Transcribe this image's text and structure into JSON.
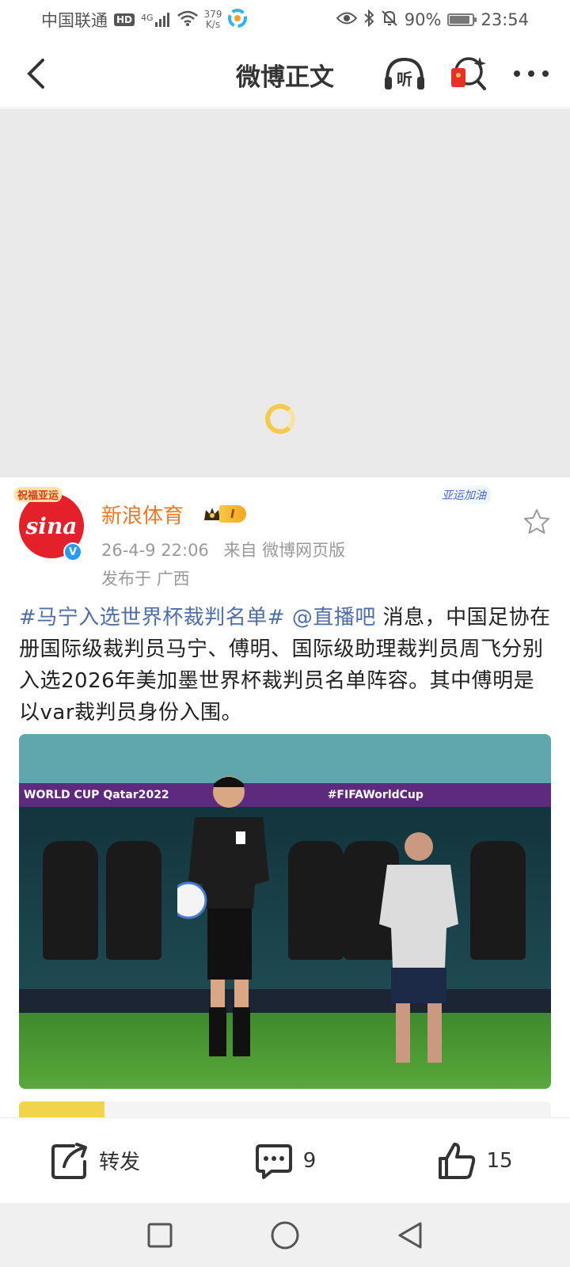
{
  "status_bar": {
    "carrier": "中国联通",
    "hd": "HD",
    "network": "4G",
    "speed_value": "379",
    "speed_unit": "K/s",
    "battery_percent": "90%",
    "battery_level": 0.9,
    "time": "23:54"
  },
  "nav": {
    "title": "微博正文",
    "listen_label": "听"
  },
  "post": {
    "avatar_badge": "祝福亚运",
    "avatar_text": "sina",
    "author": "新浪体育",
    "vip_level": "I",
    "deco_badge": "亚运加油",
    "date": "26-4-9 22:06",
    "source": "来自 微博网页版",
    "location": "发布于 广西",
    "topic": "#马宁入选世界杯裁判名单#",
    "mention": "@直播吧",
    "body": " 消息，中国足协在册国际级裁判员马宁、傅明、国际级助理裁判员周飞分别入选2026年美加墨世界杯裁判员名单阵容。其中傅明是以var裁判员身份入围。"
  },
  "image": {
    "banner_left": "WORLD CUP Qatar2022",
    "banner_right": "#FIFAWorldCup"
  },
  "actions": {
    "repost_label": "转发",
    "comment_count": "9",
    "like_count": "15"
  },
  "colors": {
    "accent_orange": "#e87b2a",
    "link_blue": "#4e6ea8",
    "sina_red": "#e4202a"
  }
}
